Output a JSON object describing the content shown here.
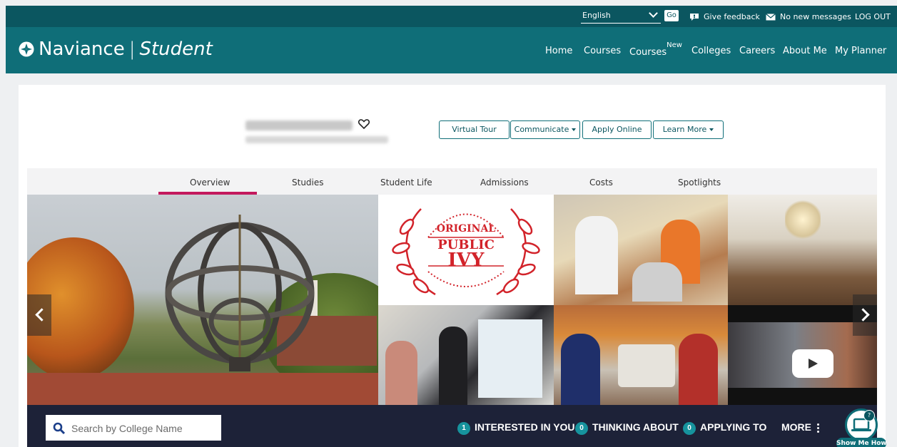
{
  "utility_bar": {
    "language": "English",
    "go_label": "Go",
    "feedback_label": "Give feedback",
    "messages_label": "No new messages",
    "logout_label": "LOG OUT"
  },
  "header": {
    "brand_name": "Naviance",
    "brand_product": "Student",
    "nav": [
      {
        "label": "Home"
      },
      {
        "label": "Courses"
      },
      {
        "label": "Courses",
        "badge": "New"
      },
      {
        "label": "Colleges"
      },
      {
        "label": "Careers"
      },
      {
        "label": "About Me"
      },
      {
        "label": "My Planner"
      }
    ]
  },
  "college": {
    "actions": {
      "virtual_tour": "Virtual Tour",
      "communicate": "Communicate",
      "apply_online": "Apply Online",
      "learn_more": "Learn More"
    }
  },
  "tabs": [
    {
      "label": "Overview",
      "active": true
    },
    {
      "label": "Studies"
    },
    {
      "label": "Student Life"
    },
    {
      "label": "Admissions"
    },
    {
      "label": "Costs"
    },
    {
      "label": "Spotlights"
    }
  ],
  "gallery": {
    "ivy_badge": {
      "line1": "ORIGINAL",
      "line2": "PUBLIC",
      "line3": "IVY"
    }
  },
  "bottom_bar": {
    "search_placeholder": "Search by College Name",
    "stats": [
      {
        "count": "1",
        "label": "INTERESTED IN YOU"
      },
      {
        "count": "0",
        "label": "THINKING ABOUT"
      },
      {
        "count": "0",
        "label": "APPLYING TO"
      }
    ],
    "more_label": "MORE"
  },
  "show_me_how": {
    "label": "Show Me How",
    "badge": "?"
  },
  "colors": {
    "header_teal": "#0f6e78",
    "utility_teal": "#0b5660",
    "tab_accent": "#c3195d",
    "bottom_bar": "#1d2238",
    "badge_teal": "#16939d"
  }
}
